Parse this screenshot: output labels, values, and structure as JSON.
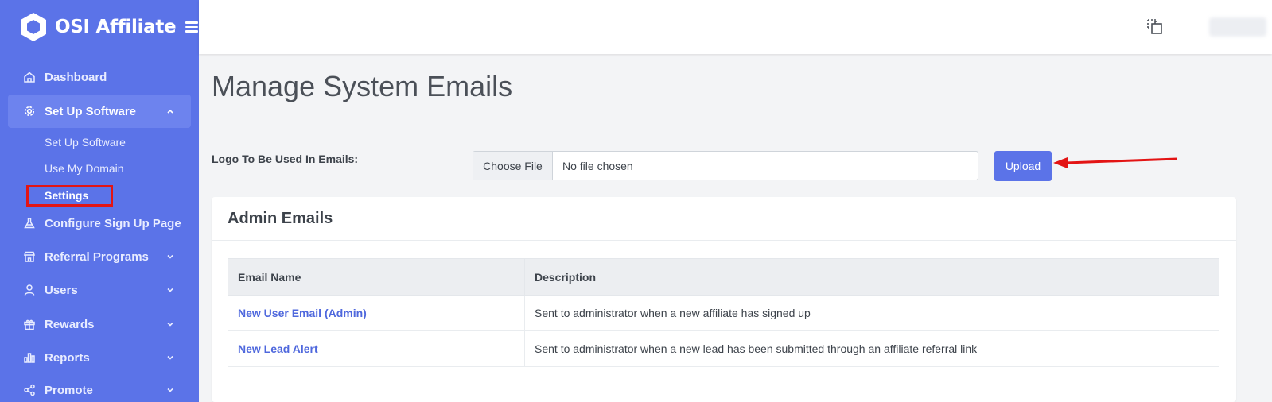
{
  "brand": {
    "name": "OSI Affiliate",
    "logo_icon": "hexagon-logo-icon",
    "menu_icon": "hamburger-icon"
  },
  "sidebar": {
    "items": [
      {
        "label": "Dashboard",
        "icon": "home-icon",
        "has_chevron": false
      },
      {
        "label": "Set Up Software",
        "icon": "gear-icon",
        "has_chevron": true,
        "expanded": true
      },
      {
        "label": "Configure Sign Up Page",
        "icon": "flask-icon",
        "has_chevron": false
      },
      {
        "label": "Referral Programs",
        "icon": "store-icon",
        "has_chevron": true
      },
      {
        "label": "Users",
        "icon": "user-icon",
        "has_chevron": true
      },
      {
        "label": "Rewards",
        "icon": "gift-icon",
        "has_chevron": true
      },
      {
        "label": "Reports",
        "icon": "bar-chart-icon",
        "has_chevron": true
      },
      {
        "label": "Promote",
        "icon": "share-icon",
        "has_chevron": true
      }
    ],
    "subitems": [
      {
        "label": "Set Up Software"
      },
      {
        "label": "Use My Domain"
      },
      {
        "label": "Settings",
        "current": true
      }
    ],
    "accent_color": "#5b73e8"
  },
  "topbar": {
    "icons": [
      "fullscreen-icon"
    ]
  },
  "main": {
    "title": "Manage System Emails",
    "logo_field": {
      "label": "Logo To Be Used In Emails:",
      "choose_label": "Choose File",
      "status": "No file chosen"
    },
    "upload_label": "Upload",
    "annotation_color": "#e31414"
  },
  "admin_emails": {
    "title": "Admin Emails",
    "columns": [
      "Email Name",
      "Description"
    ],
    "rows": [
      {
        "name": "New User Email (Admin)",
        "description": "Sent to administrator when a new affiliate has signed up"
      },
      {
        "name": "New Lead Alert",
        "description": "Sent to administrator when a new lead has been submitted through an affiliate referral link"
      }
    ]
  }
}
